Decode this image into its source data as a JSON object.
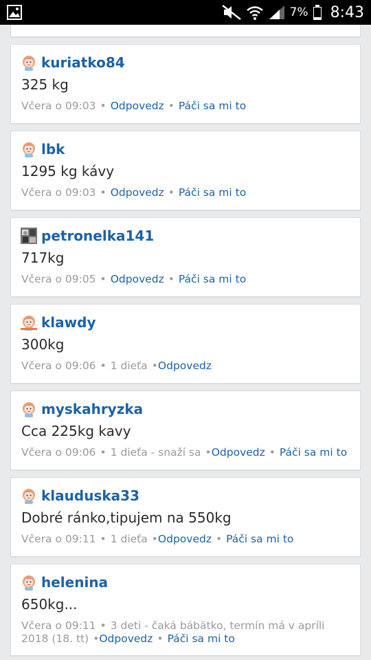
{
  "status_bar": {
    "battery": "7%",
    "time": "8:43"
  },
  "posts": [
    {
      "user": "kuriatko84",
      "text": "325 kg",
      "time": "Včera o 09:03",
      "info": "",
      "reply": "Odpovedz",
      "like": "Páči sa mi to",
      "avatar": "girl-avatar-icon"
    },
    {
      "user": "lbk",
      "text": "1295 kg kávy",
      "time": "Včera o 09:03",
      "info": "",
      "reply": "Odpovedz",
      "like": "Páči sa mi to",
      "avatar": "girl-avatar-icon"
    },
    {
      "user": "petronelka141",
      "text": "717kg",
      "time": "Včera o 09:05",
      "info": "",
      "reply": "Odpovedz",
      "like": "Páči sa mi to",
      "avatar": "photo-avatar-icon"
    },
    {
      "user": "klawdy",
      "text": "300kg",
      "time": "Včera o 09:06",
      "info": "1 dieťa",
      "reply": "Odpovedz",
      "like": "",
      "avatar": "girl-avatar-icon"
    },
    {
      "user": "myskahryzka",
      "text": "Cca 225kg kavy",
      "time": "Včera o 09:06",
      "info": "1 dieťa - snaží sa",
      "reply": "Odpovedz",
      "like": "Páči sa mi to",
      "avatar": "girl-avatar-icon"
    },
    {
      "user": "klauduska33",
      "text": "Dobré ránko,tipujem na 550kg",
      "time": "Včera o 09:11",
      "info": "1 dieťa",
      "reply": "Odpovedz",
      "like": "Páči sa mi to",
      "avatar": "girl-avatar-icon"
    },
    {
      "user": "helenina",
      "text": "650kg...",
      "time": "Včera o 09:11",
      "info": "3 deti - čaká bábätko, termín má v apríli 2018 (18. tt)",
      "reply": "Odpovedz",
      "like": "Páči sa mi to",
      "avatar": "girl-avatar-icon"
    }
  ],
  "colors": {
    "link": "#1b62a8",
    "meta": "#9a9a9a",
    "background": "#e8eaec"
  }
}
